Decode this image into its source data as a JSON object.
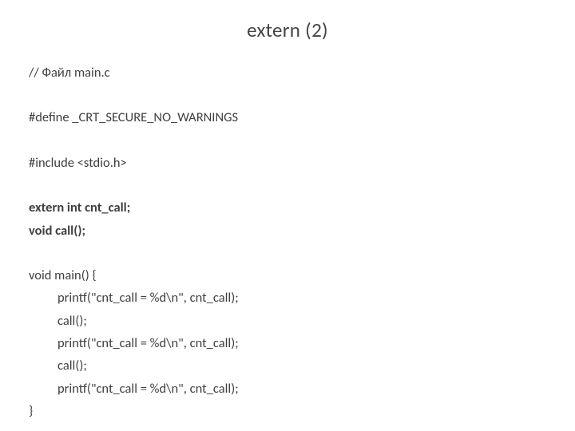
{
  "title": "extern (2)",
  "code": {
    "lines": [
      {
        "text": "// Файл main.c",
        "bold": false,
        "indent": false
      },
      {
        "text": "",
        "bold": false,
        "indent": false,
        "blank": true
      },
      {
        "text": "#define _CRT_SECURE_NO_WARNINGS",
        "bold": false,
        "indent": false
      },
      {
        "text": "",
        "bold": false,
        "indent": false,
        "blank": true
      },
      {
        "text": "#include <stdio.h>",
        "bold": false,
        "indent": false
      },
      {
        "text": "",
        "bold": false,
        "indent": false,
        "blank": true
      },
      {
        "text": "extern int cnt_call;",
        "bold": true,
        "indent": false
      },
      {
        "text": "void call();",
        "bold": true,
        "indent": false
      },
      {
        "text": "",
        "bold": false,
        "indent": false,
        "blank": true
      },
      {
        "text": "void main() {",
        "bold": false,
        "indent": false
      },
      {
        "text": "printf(\"cnt_call = %d\\n\", cnt_call);",
        "bold": false,
        "indent": true
      },
      {
        "text": "call();",
        "bold": false,
        "indent": true
      },
      {
        "text": "printf(\"cnt_call = %d\\n\", cnt_call);",
        "bold": false,
        "indent": true
      },
      {
        "text": "call();",
        "bold": false,
        "indent": true
      },
      {
        "text": "printf(\"cnt_call = %d\\n\", cnt_call);",
        "bold": false,
        "indent": true
      },
      {
        "text": "}",
        "bold": false,
        "indent": false
      }
    ]
  }
}
